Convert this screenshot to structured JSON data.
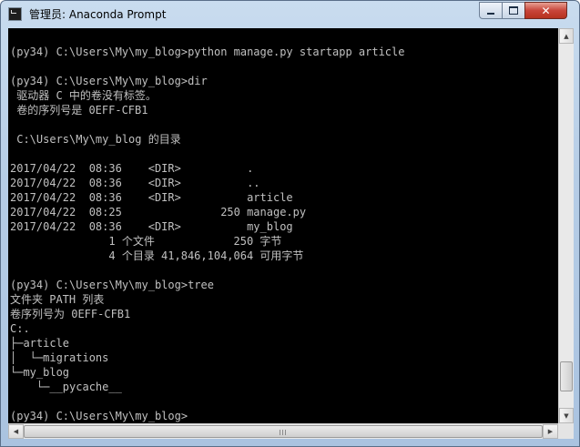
{
  "window": {
    "title": "管理员: Anaconda Prompt",
    "controls": {
      "minimize": "–",
      "maximize": "□",
      "close": "✕"
    }
  },
  "console": {
    "lines": [
      "",
      "(py34) C:\\Users\\My\\my_blog>python manage.py startapp article",
      "",
      "(py34) C:\\Users\\My\\my_blog>dir",
      " 驱动器 C 中的卷没有标签。",
      " 卷的序列号是 0EFF-CFB1",
      "",
      " C:\\Users\\My\\my_blog 的目录",
      "",
      "2017/04/22  08:36    <DIR>          .",
      "2017/04/22  08:36    <DIR>          ..",
      "2017/04/22  08:36    <DIR>          article",
      "2017/04/22  08:25               250 manage.py",
      "2017/04/22  08:36    <DIR>          my_blog",
      "               1 个文件            250 字节",
      "               4 个目录 41,846,104,064 可用字节",
      "",
      "(py34) C:\\Users\\My\\my_blog>tree",
      "文件夹 PATH 列表",
      "卷序列号为 0EFF-CFB1",
      "C:.",
      "├─article",
      "│  └─migrations",
      "└─my_blog",
      "    └─__pycache__",
      "",
      "(py34) C:\\Users\\My\\my_blog>"
    ]
  },
  "scrollbars": {
    "vertical": {
      "position": 0.95
    },
    "horizontal": {
      "position": 0.0
    }
  },
  "icons": {
    "app": "console-icon",
    "up": "▲",
    "down": "▼",
    "left": "◀",
    "right": "▶"
  },
  "colors": {
    "console_bg": "#000000",
    "console_fg": "#c0c0c0",
    "titlebar": "#b6cde6",
    "close": "#c8453a"
  }
}
